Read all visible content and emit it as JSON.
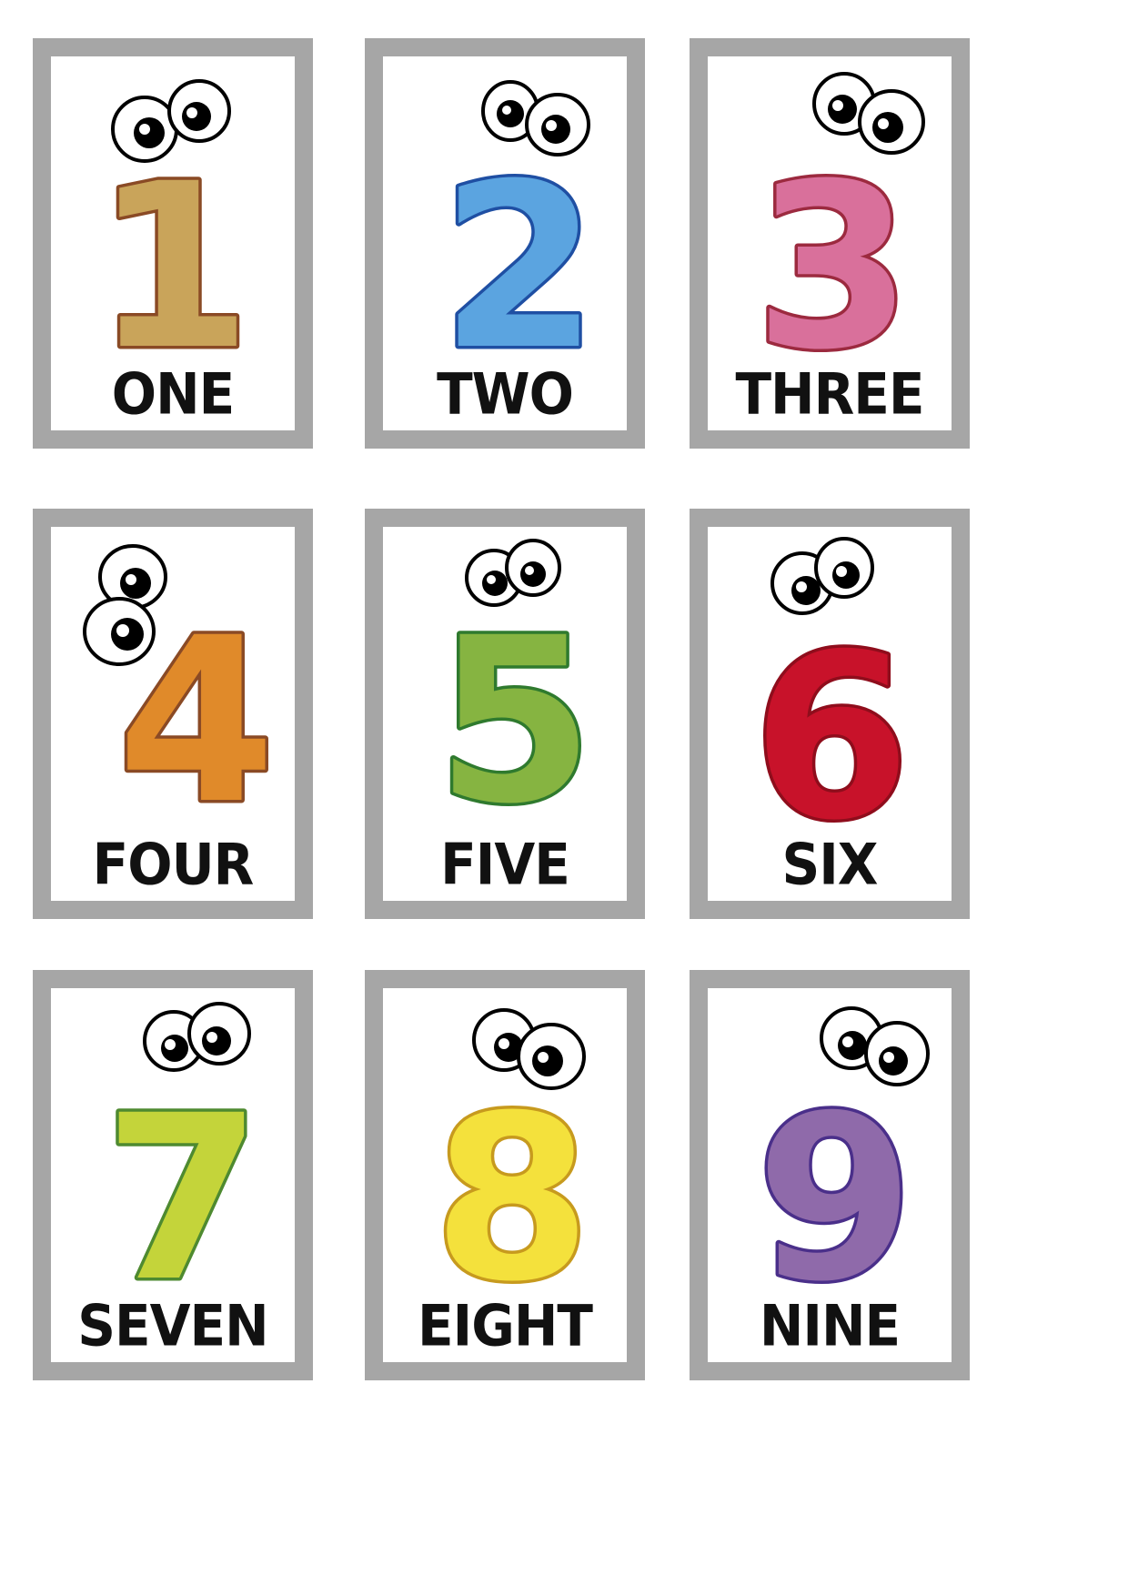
{
  "cards": [
    {
      "numeral": "1",
      "word": "ONE",
      "fill": "#c9a45a",
      "outline": "#8a4a25"
    },
    {
      "numeral": "2",
      "word": "TWO",
      "fill": "#5ba4e0",
      "outline": "#1f4fa3"
    },
    {
      "numeral": "3",
      "word": "THREE",
      "fill": "#d9709b",
      "outline": "#9c2a3f"
    },
    {
      "numeral": "4",
      "word": "FOUR",
      "fill": "#e08a2a",
      "outline": "#8a4a25"
    },
    {
      "numeral": "5",
      "word": "FIVE",
      "fill": "#86b441",
      "outline": "#2f7a2e"
    },
    {
      "numeral": "6",
      "word": "SIX",
      "fill": "#c8122a",
      "outline": "#8f0d1c"
    },
    {
      "numeral": "7",
      "word": "SEVEN",
      "fill": "#c4d43a",
      "outline": "#4e8a30"
    },
    {
      "numeral": "8",
      "word": "EIGHT",
      "fill": "#f4e13c",
      "outline": "#c79a1e"
    },
    {
      "numeral": "9",
      "word": "NINE",
      "fill": "#8f6aaa",
      "outline": "#4a2f8a"
    }
  ],
  "colors": {
    "card_border": "#a6a6a6",
    "word": "#111111"
  }
}
